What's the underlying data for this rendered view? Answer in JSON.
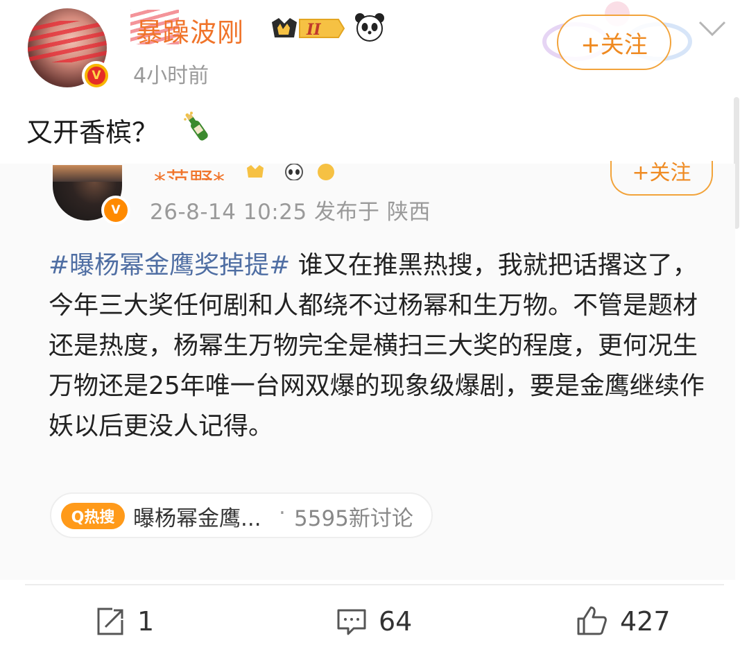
{
  "author": {
    "name": "暴躁波刚",
    "time_ago": "4小时前",
    "vip_level": "II",
    "verified": true
  },
  "follow_label": "+关注",
  "post": {
    "text": "又开香槟？",
    "emoji": "champagne-icon"
  },
  "retweet": {
    "author_name_partial": "*范野*",
    "follow_label": "+关注",
    "meta": "26-8-14 10:25  发布于 陕西",
    "hashtag": "#曝杨幂金鹰奖掉提#",
    "body": " 谁又在推黑热搜，我就把话撂这了，今年三大奖任何剧和人都绕不过杨幂和生万物。不管是题材还是热度，杨幂生万物完全是横扫三大奖的程度，更何况生万物还是25年唯一台网双爆的现象级爆剧，要是金鹰继续作妖以后更没人记得。"
  },
  "hot_search": {
    "badge": "Q热搜",
    "title": "曝杨幂金鹰...",
    "separator": "·",
    "count": "5595新讨论"
  },
  "actions": {
    "repost": "1",
    "comment": "64",
    "like": "427"
  },
  "colors": {
    "orange": "#f0742a",
    "link_blue": "#4f6ea3",
    "hot_badge": "#ff9a1a"
  }
}
